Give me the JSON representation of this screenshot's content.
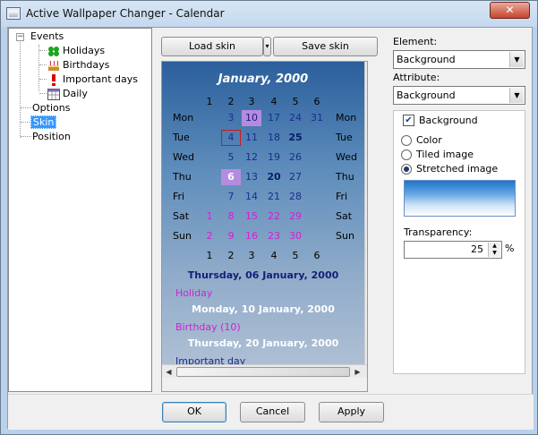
{
  "window": {
    "title": "Active Wallpaper Changer - Calendar",
    "close": "✕"
  },
  "tree": {
    "events": "Events",
    "holidays": "Holidays",
    "birthdays": "Birthdays",
    "important_days": "Important days",
    "daily": "Daily",
    "options": "Options",
    "skin": "Skin",
    "position": "Position",
    "expander": "−"
  },
  "skin_buttons": {
    "load": "Load skin",
    "save": "Save skin",
    "arrow": "▾"
  },
  "calendar": {
    "title": "January, 2000",
    "header_days": [
      "1",
      "2",
      "3",
      "4",
      "5",
      "6"
    ],
    "footer_days": [
      "1",
      "2",
      "3",
      "4",
      "5",
      "6"
    ],
    "weekdays": [
      "Mon",
      "Tue",
      "Wed",
      "Thu",
      "Fri",
      "Sat",
      "Sun"
    ],
    "rows": [
      [
        "",
        "3",
        "10",
        "17",
        "24",
        "31"
      ],
      [
        "",
        "4",
        "11",
        "18",
        "25",
        ""
      ],
      [
        "",
        "5",
        "12",
        "19",
        "26",
        ""
      ],
      [
        "",
        "6",
        "13",
        "20",
        "27",
        ""
      ],
      [
        "",
        "7",
        "14",
        "21",
        "28",
        ""
      ],
      [
        "1",
        "8",
        "15",
        "22",
        "29",
        ""
      ],
      [
        "2",
        "9",
        "16",
        "23",
        "30",
        ""
      ]
    ],
    "events": [
      {
        "date": "Thursday, 06 January, 2000",
        "label": "Holiday"
      },
      {
        "date": "Monday, 10 January, 2000",
        "label": "Birthday (10)"
      },
      {
        "date": "Thursday, 20 January, 2000",
        "label": "Important day"
      }
    ]
  },
  "right": {
    "element_label": "Element:",
    "element_value": "Background",
    "attribute_label": "Attribute:",
    "attribute_value": "Background",
    "bg_checkbox": "Background",
    "check": "✔",
    "radio_color": "Color",
    "radio_tiled": "Tiled image",
    "radio_stretched": "Stretched image",
    "transparency_label": "Transparency:",
    "transparency_value": "25",
    "percent": "%",
    "dd_arrow": "▼"
  },
  "bottom": {
    "ok": "OK",
    "cancel": "Cancel",
    "apply": "Apply"
  },
  "scroll": {
    "up": "▲",
    "down": "▼",
    "left": "◀",
    "right": "▶"
  }
}
